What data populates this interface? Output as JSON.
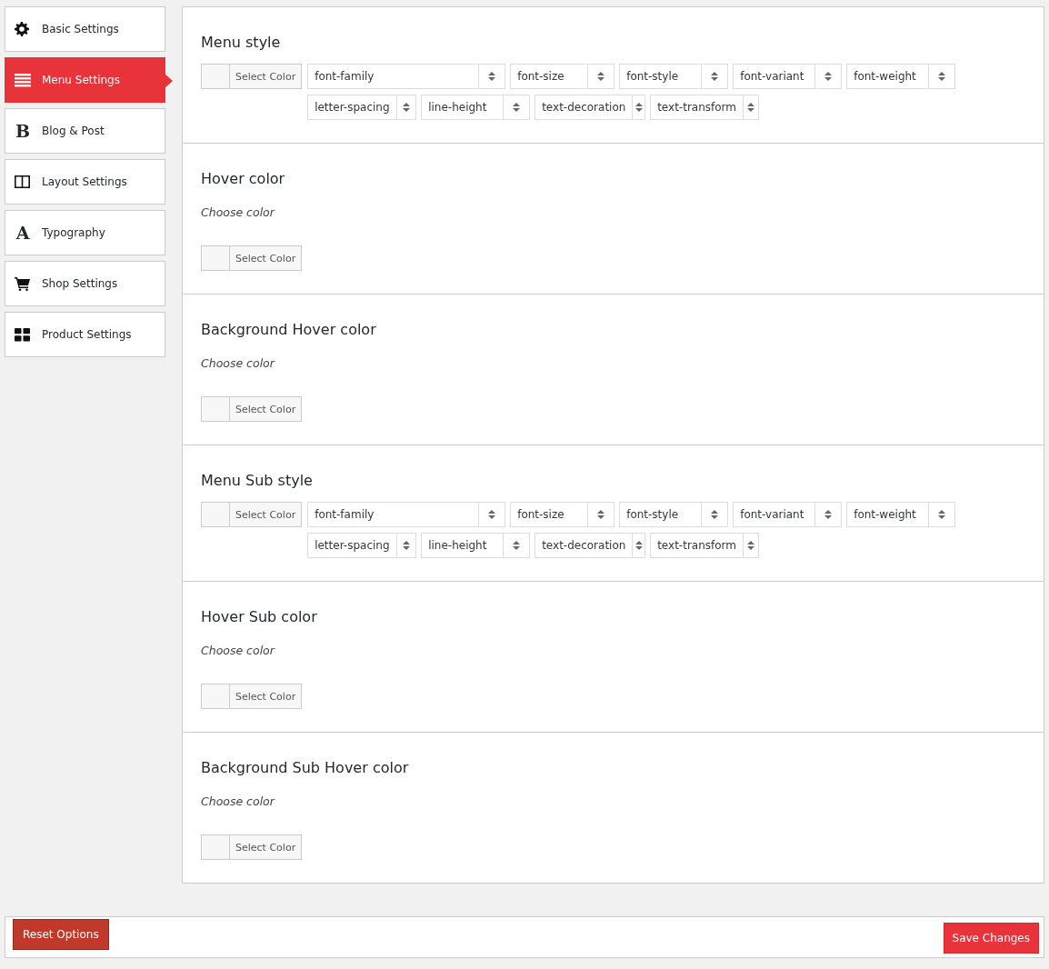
{
  "sidebar": {
    "items": [
      {
        "label": "Basic Settings",
        "kind": "gear",
        "selected": false
      },
      {
        "label": "Menu Settings",
        "kind": "list",
        "selected": true
      },
      {
        "label": "Blog & Post",
        "kind": "glyph",
        "glyph": "B",
        "selected": false
      },
      {
        "label": "Layout Settings",
        "kind": "columns",
        "selected": false
      },
      {
        "label": "Typography",
        "kind": "glyph",
        "glyph": "A",
        "selected": false
      },
      {
        "label": "Shop Settings",
        "kind": "cart",
        "selected": false
      },
      {
        "label": "Product Settings",
        "kind": "grid",
        "selected": false
      }
    ]
  },
  "sections": [
    {
      "kind": "typography",
      "title": "Menu style",
      "color_button": "Select Color",
      "selects": [
        [
          "font-family",
          "font-size",
          "font-style",
          "font-variant",
          "font-weight"
        ],
        [
          "letter-spacing",
          "line-height",
          "text-decoration",
          "text-transform"
        ]
      ]
    },
    {
      "kind": "color",
      "title": "Hover color",
      "description": "Choose color",
      "color_button": "Select Color"
    },
    {
      "kind": "color",
      "title": "Background Hover color",
      "description": "Choose color",
      "color_button": "Select Color"
    },
    {
      "kind": "typography",
      "title": "Menu Sub style",
      "color_button": "Select Color",
      "selects": [
        [
          "font-family",
          "font-size",
          "font-style",
          "font-variant",
          "font-weight"
        ],
        [
          "letter-spacing",
          "line-height",
          "text-decoration",
          "text-transform"
        ]
      ]
    },
    {
      "kind": "color",
      "title": "Hover Sub color",
      "description": "Choose color",
      "color_button": "Select Color"
    },
    {
      "kind": "color",
      "title": "Background Sub Hover color",
      "description": "Choose color",
      "color_button": "Select Color"
    }
  ],
  "footer": {
    "reset_button": "Reset Options",
    "save_button": "Save Changes"
  }
}
